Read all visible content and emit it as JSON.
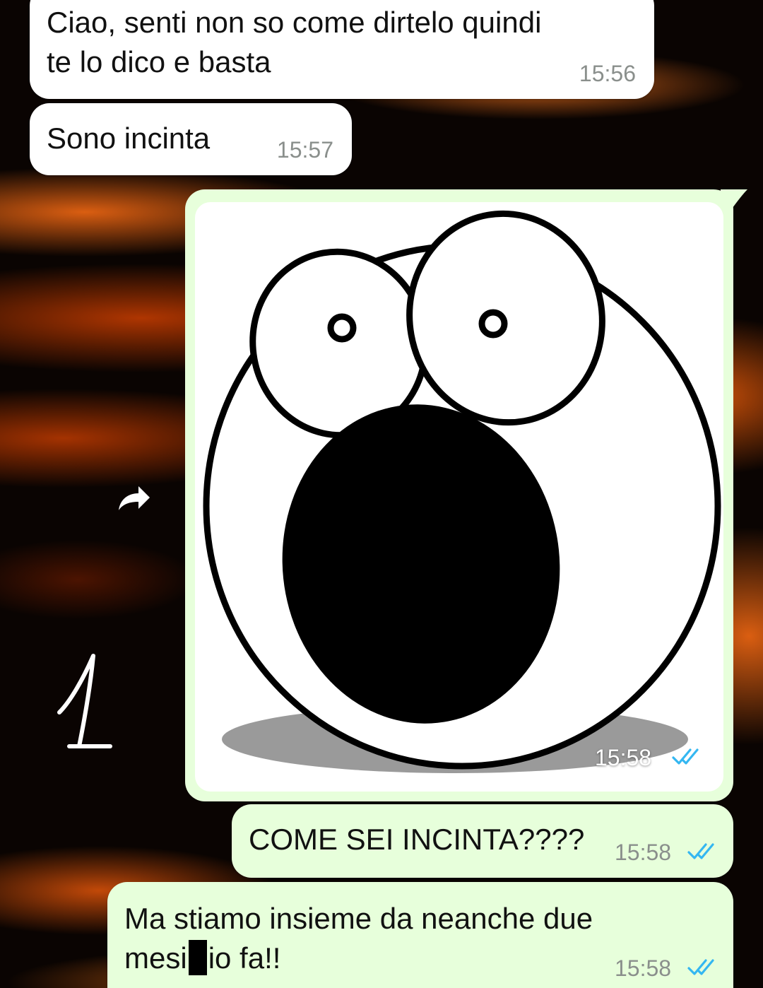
{
  "messages": [
    {
      "direction": "incoming",
      "text": "Ciao, senti non so come dirtelo quindi\nte lo dico e basta",
      "time": "15:56"
    },
    {
      "direction": "incoming",
      "text": "Sono incinta",
      "time": "15:57"
    },
    {
      "direction": "outgoing",
      "type": "sticker",
      "sticker_icon": "shocked-face-sticker",
      "time": "15:58",
      "status": "read"
    },
    {
      "direction": "outgoing",
      "text": "COME SEI INCINTA????",
      "time": "15:58",
      "status": "read"
    },
    {
      "direction": "outgoing",
      "text_before_redaction": "Ma stiamo insieme da neanche due\nmesi",
      "text_after_redaction": "io fa!!",
      "time": "15:58",
      "status": "read"
    }
  ],
  "forward_icon": "forward-arrow-icon",
  "annotation": "1",
  "colors": {
    "incoming_bubble": "#ffffff",
    "outgoing_bubble": "#e7ffdb",
    "read_ticks": "#34b7f1",
    "timestamp": "#8a8f8c"
  }
}
